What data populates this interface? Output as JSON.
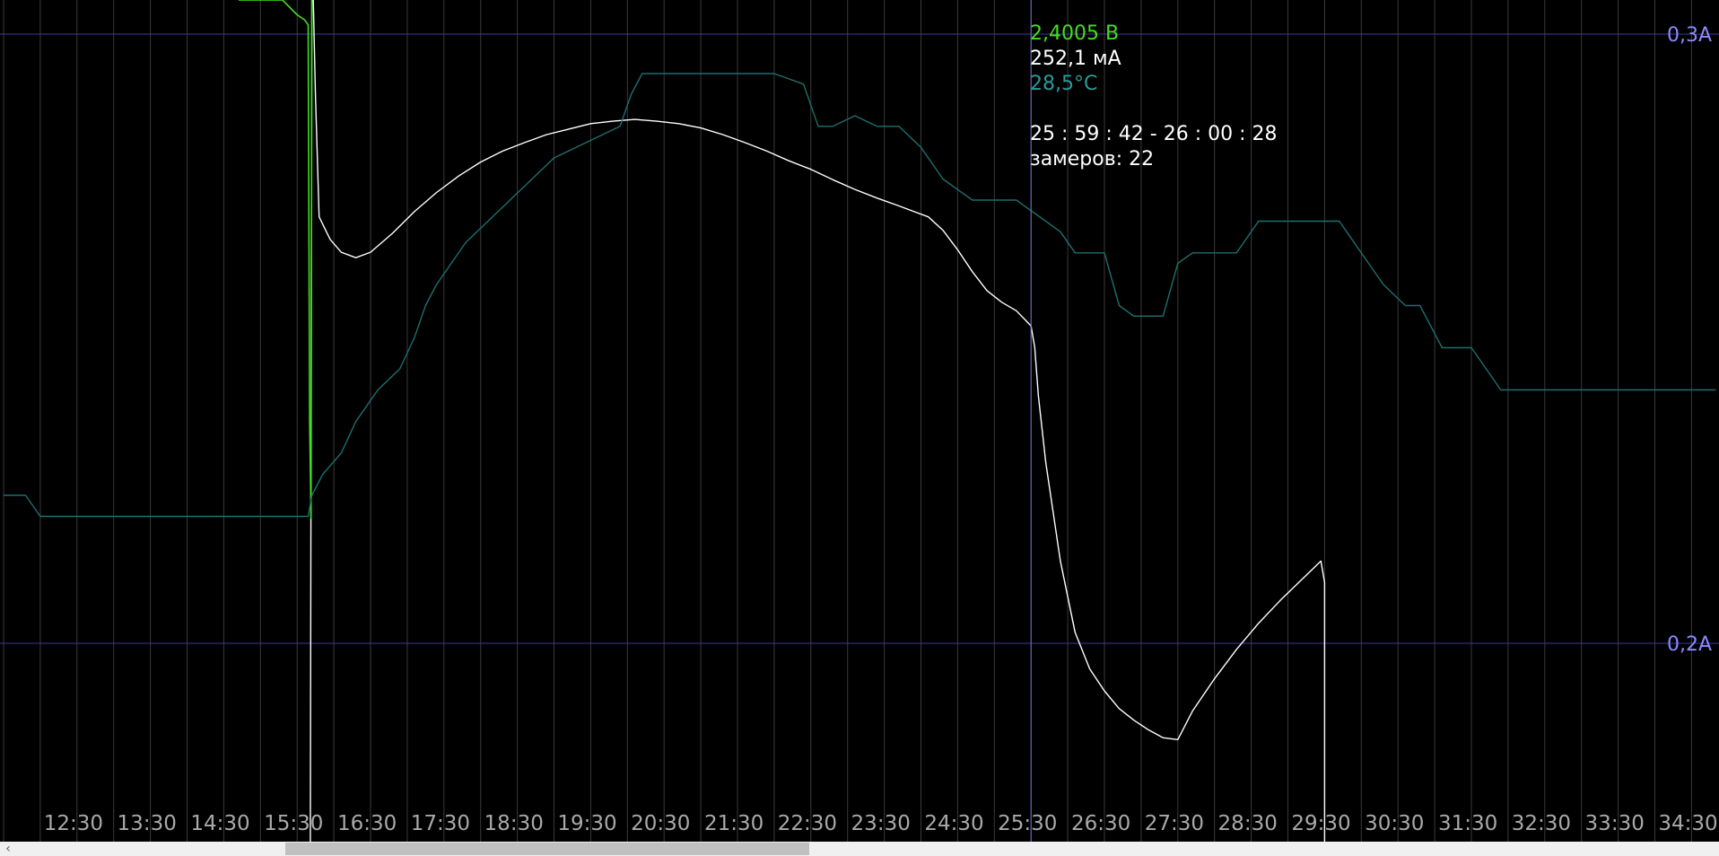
{
  "readout": {
    "voltage": "2,4005 В",
    "current": "252,1 мА",
    "temperature": "28,5°C",
    "time_range": "25 : 59 : 42 - 26 : 00 : 28",
    "samples": "замеров: 22"
  },
  "colors": {
    "background": "#000000",
    "voltage": "#44dd22",
    "current": "#ffffff",
    "temperature": "#1f6e6e",
    "reference_line": "#3a3aa0",
    "vertical_grid": "#3a3a3a",
    "tick_text": "#a9a9a9",
    "ylabel_text": "#8a8aff"
  },
  "chart_data": {
    "type": "line",
    "x_ticks": [
      "12:30",
      "13:30",
      "14:30",
      "15:30",
      "16:30",
      "17:30",
      "18:30",
      "19:30",
      "20:30",
      "21:30",
      "22:30",
      "23:30",
      "24:30",
      "25:30",
      "26:30",
      "27:30",
      "28:30",
      "29:30",
      "30:30",
      "31:30",
      "32:30",
      "33:30",
      "34:30"
    ],
    "x_range": [
      12.0,
      35.33
    ],
    "y_reference_lines": [
      {
        "label": "0,3A",
        "value": 0.3
      },
      {
        "label": "0,2A",
        "value": 0.2
      }
    ],
    "ylim": [
      0.0694,
      0.3555
    ],
    "cursor_x": 26.0,
    "series": [
      {
        "key": "current",
        "x": [
          16.18,
          16.2,
          16.22,
          16.25,
          16.3,
          16.45,
          16.6,
          16.8,
          17.0,
          17.3,
          17.6,
          17.9,
          18.2,
          18.5,
          18.8,
          19.1,
          19.4,
          19.7,
          20.0,
          20.3,
          20.6,
          20.9,
          21.2,
          21.5,
          21.8,
          22.1,
          22.4,
          22.7,
          23.0,
          23.3,
          23.6,
          23.9,
          24.2,
          24.4,
          24.6,
          24.8,
          25.0,
          25.2,
          25.4,
          25.6,
          25.8,
          26.0,
          26.05,
          26.1,
          26.2,
          26.4,
          26.6,
          26.8,
          27.0,
          27.2,
          27.4,
          27.6,
          27.8,
          28.0,
          28.2,
          28.5,
          28.8,
          29.1,
          29.4,
          29.7,
          29.95,
          30.0,
          30.0
        ],
        "y": [
          0.0694,
          0.3555,
          0.32,
          0.29,
          0.27,
          0.2663,
          0.2642,
          0.2633,
          0.2642,
          0.2673,
          0.2709,
          0.274,
          0.2767,
          0.279,
          0.2808,
          0.2822,
          0.2835,
          0.2844,
          0.2853,
          0.2857,
          0.286,
          0.2857,
          0.2853,
          0.2846,
          0.2835,
          0.2822,
          0.2808,
          0.2792,
          0.2778,
          0.2761,
          0.2745,
          0.2731,
          0.2718,
          0.2709,
          0.27,
          0.2678,
          0.2646,
          0.261,
          0.2579,
          0.256,
          0.2546,
          0.2521,
          0.2486,
          0.2406,
          0.2297,
          0.2135,
          0.2018,
          0.1958,
          0.1922,
          0.1893,
          0.1874,
          0.1858,
          0.1845,
          0.1842,
          0.1889,
          0.1942,
          0.199,
          0.2033,
          0.2071,
          0.2106,
          0.2135,
          0.21,
          0.0694
        ]
      },
      {
        "key": "voltage",
        "x": [
          15.2,
          15.5,
          15.8,
          16.0,
          16.1,
          16.15,
          16.17,
          16.19,
          16.2,
          16.21
        ],
        "y": [
          2.48,
          2.45,
          2.43,
          2.41,
          2.405,
          2.4,
          2.0,
          1.9,
          2.55,
          2.55
        ]
      },
      {
        "key": "temperature",
        "x": [
          12.0,
          12.3,
          12.5,
          12.7,
          16.15,
          16.2,
          16.35,
          16.6,
          16.8,
          17.1,
          17.4,
          17.6,
          17.75,
          17.9,
          18.1,
          18.3,
          18.6,
          18.9,
          19.2,
          19.5,
          19.8,
          20.1,
          20.4,
          20.55,
          20.7,
          21.0,
          21.5,
          22.0,
          22.5,
          22.9,
          23.1,
          23.3,
          23.6,
          23.9,
          24.2,
          24.5,
          24.8,
          25.0,
          25.2,
          25.5,
          25.8,
          26.0,
          26.2,
          26.4,
          26.6,
          26.8,
          27.0,
          27.2,
          27.4,
          27.6,
          27.8,
          28.0,
          28.2,
          28.5,
          28.8,
          29.1,
          29.4,
          29.7,
          30.0,
          30.2,
          30.5,
          30.8,
          31.1,
          31.3,
          31.6,
          31.9,
          32.0,
          32.2,
          32.4,
          32.7,
          33.0,
          33.5,
          34.0,
          34.5,
          35.0,
          35.33
        ],
        "y": [
          0.2,
          0.2,
          0.19,
          0.19,
          0.19,
          0.2,
          0.21,
          0.22,
          0.235,
          0.25,
          0.26,
          0.275,
          0.29,
          0.3,
          0.31,
          0.32,
          0.33,
          0.34,
          0.35,
          0.36,
          0.365,
          0.37,
          0.375,
          0.39,
          0.4,
          0.4,
          0.4,
          0.4,
          0.4,
          0.395,
          0.375,
          0.375,
          0.38,
          0.375,
          0.375,
          0.365,
          0.35,
          0.345,
          0.34,
          0.34,
          0.34,
          0.335,
          0.33,
          0.325,
          0.315,
          0.315,
          0.315,
          0.29,
          0.285,
          0.285,
          0.285,
          0.31,
          0.315,
          0.315,
          0.315,
          0.33,
          0.33,
          0.33,
          0.33,
          0.33,
          0.315,
          0.3,
          0.29,
          0.29,
          0.27,
          0.27,
          0.27,
          0.26,
          0.25,
          0.25,
          0.25,
          0.25,
          0.25,
          0.25,
          0.25,
          0.25
        ]
      }
    ]
  },
  "scrollbar": {
    "left_arrow": "‹"
  }
}
